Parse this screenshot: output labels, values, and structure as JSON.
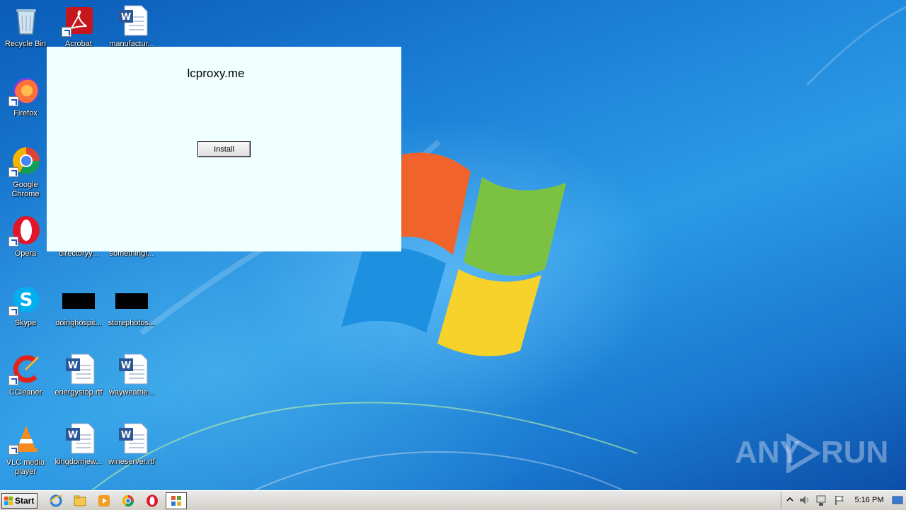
{
  "desktop_icons": [
    {
      "name": "recycle-bin",
      "label": "Recycle Bin",
      "icon": "recycle-bin-icon"
    },
    {
      "name": "acrobat",
      "label": "Acrobat",
      "icon": "acrobat-icon"
    },
    {
      "name": "manufactur",
      "label": "manufactur...",
      "icon": "word-doc-icon"
    },
    {
      "name": "firefox",
      "label": "Firefox",
      "icon": "firefox-icon"
    },
    {
      "name": "google-chrome",
      "label": "Google Chrome",
      "icon": "chrome-icon"
    },
    {
      "name": "opera",
      "label": "Opera",
      "icon": "opera-icon"
    },
    {
      "name": "directoryy",
      "label": "directoryy...",
      "icon": "word-doc-icon"
    },
    {
      "name": "somethingf",
      "label": "somethingf...",
      "icon": "word-doc-icon"
    },
    {
      "name": "skype",
      "label": "Skype",
      "icon": "skype-icon"
    },
    {
      "name": "doinghospit",
      "label": "doinghospit...",
      "icon": "blank-file-icon"
    },
    {
      "name": "storephotos",
      "label": "storephotos...",
      "icon": "blank-file-icon"
    },
    {
      "name": "ccleaner",
      "label": "CCleaner",
      "icon": "ccleaner-icon"
    },
    {
      "name": "energystop",
      "label": "energystop.rtf",
      "icon": "word-doc-icon"
    },
    {
      "name": "wayweather",
      "label": "wayweathe...",
      "icon": "word-doc-icon"
    },
    {
      "name": "vlc",
      "label": "VLC media player",
      "icon": "vlc-icon"
    },
    {
      "name": "kingdomjew",
      "label": "kingdomjew...",
      "icon": "word-doc-icon"
    },
    {
      "name": "wineserver",
      "label": "wineserver.rtf",
      "icon": "word-doc-icon"
    }
  ],
  "popup": {
    "title": "lcproxy.me",
    "install_label": "Install",
    "background": "#f0ffff"
  },
  "watermark": {
    "left": "ANY",
    "right": "RUN"
  },
  "taskbar": {
    "start_label": "Start",
    "pinned": [
      "internet-explorer-icon",
      "file-explorer-icon",
      "media-player-icon",
      "chrome-icon",
      "opera-icon",
      "active-app-icon"
    ],
    "tray_icons": [
      "show-hidden-icons-icon",
      "volume-icon",
      "network-icon",
      "action-center-flag-icon"
    ],
    "clock": "5:16 PM"
  }
}
